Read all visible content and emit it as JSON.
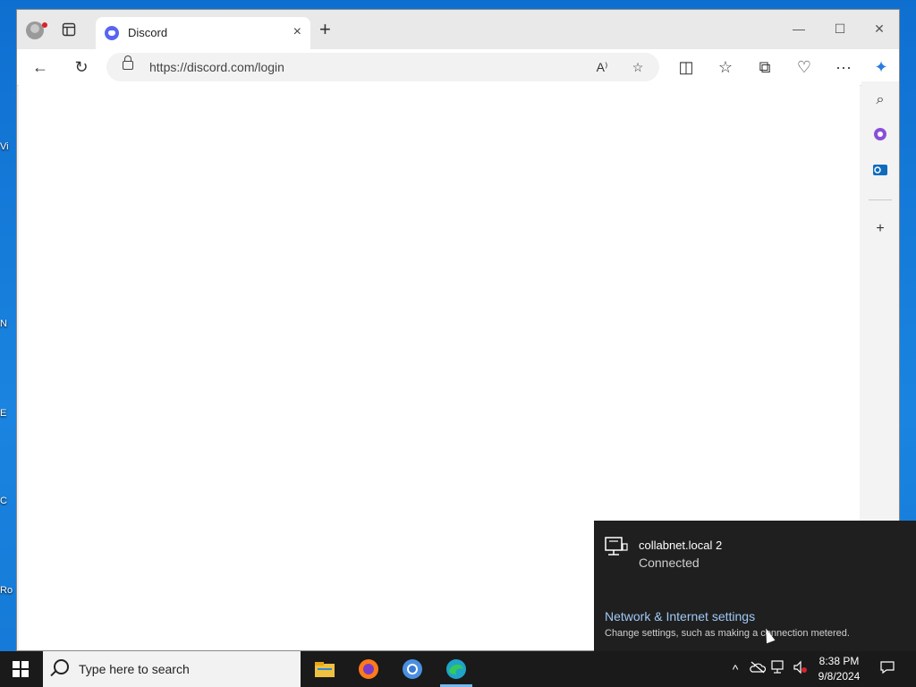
{
  "desktop": {
    "icon_fragments": [
      "Vi",
      "N",
      "E",
      "C",
      "Ro"
    ]
  },
  "browser": {
    "tab": {
      "title": "Discord",
      "close": "×"
    },
    "new_tab": "+",
    "controls": {
      "minimize": "—",
      "maximize": "☐",
      "close": "✕"
    },
    "nav": {
      "back": "←",
      "refresh": "↻"
    },
    "address": {
      "url": "https://discord.com/login"
    },
    "addr_icons": {
      "read_aloud": "A⁾",
      "favorite": "☆"
    },
    "toolbar": {
      "split": "◫",
      "favorites": "☆",
      "collections": "⧉",
      "health": "♡",
      "more": "···",
      "copilot": "✦"
    },
    "sidebar": {
      "search": "⌕",
      "add": "+"
    }
  },
  "network_flyout": {
    "network_name": "collabnet.local 2",
    "status": "Connected",
    "settings_link": "Network & Internet settings",
    "settings_desc": "Change settings, such as making a connection metered."
  },
  "taskbar": {
    "search_placeholder": "Type here to search",
    "tray": {
      "chevron": "^"
    },
    "clock": {
      "time": "8:38 PM",
      "date": "9/8/2024"
    }
  }
}
